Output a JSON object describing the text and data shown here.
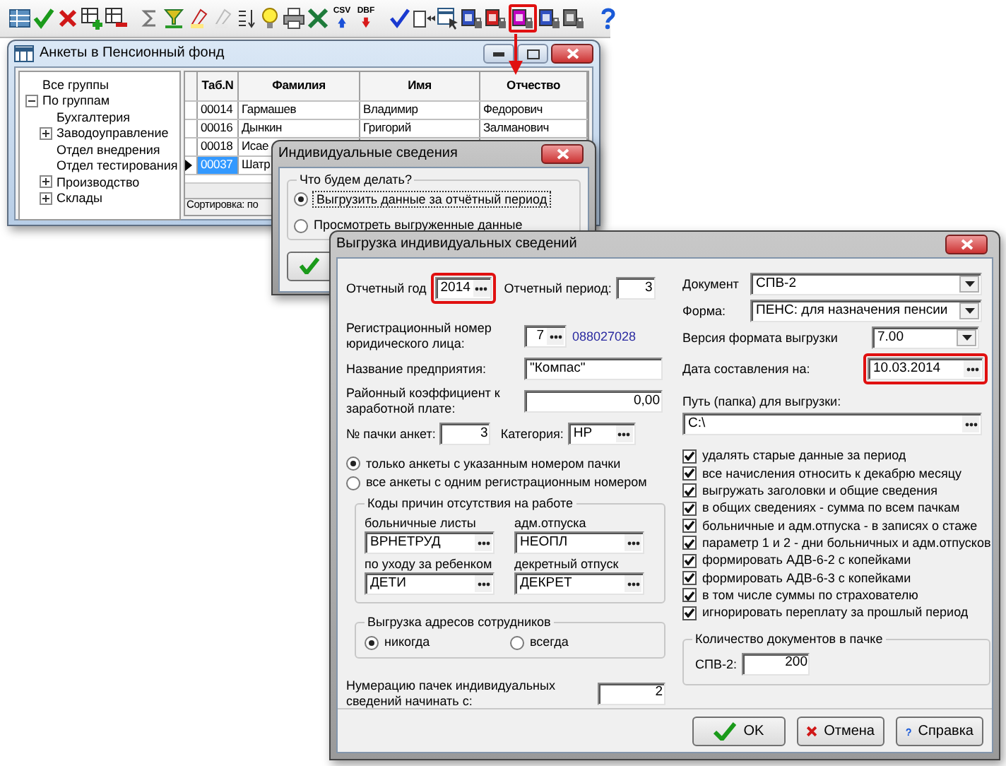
{
  "toolbar": {
    "groups": [
      [
        {
          "kind": "grid",
          "disabled": false,
          "highlighted": false
        },
        {
          "kind": "check",
          "disabled": false,
          "highlighted": false
        },
        {
          "kind": "cross",
          "disabled": false,
          "highlighted": false
        },
        {
          "kind": "add-row",
          "disabled": false,
          "highlighted": false
        },
        {
          "kind": "remove-row",
          "disabled": false,
          "highlighted": false
        }
      ],
      [
        {
          "kind": "sigma",
          "disabled": false,
          "highlighted": false
        },
        {
          "kind": "filter",
          "disabled": false,
          "highlighted": false
        },
        {
          "kind": "marker",
          "disabled": false,
          "highlighted": false
        },
        {
          "kind": "marker",
          "disabled": true,
          "highlighted": false
        },
        {
          "kind": "sort",
          "disabled": false,
          "highlighted": false
        },
        {
          "kind": "bulb",
          "disabled": false,
          "highlighted": false
        },
        {
          "kind": "printer",
          "disabled": false,
          "highlighted": false
        },
        {
          "kind": "excel",
          "disabled": false,
          "highlighted": false
        },
        {
          "kind": "export",
          "label": "CSV",
          "disabled": false,
          "highlighted": false
        },
        {
          "kind": "export-red",
          "label": "DBF",
          "disabled": false,
          "highlighted": false
        }
      ],
      [
        {
          "kind": "blue-check",
          "disabled": false,
          "highlighted": false
        },
        {
          "kind": "doc-arrow",
          "disabled": false,
          "highlighted": false
        },
        {
          "kind": "table-cursor",
          "disabled": false,
          "highlighted": false
        },
        {
          "kind": "doc-lock",
          "color": "#3050c0",
          "disabled": false,
          "highlighted": false
        },
        {
          "kind": "doc-lock",
          "color": "#d02020",
          "disabled": false,
          "highlighted": false
        },
        {
          "kind": "doc-lock",
          "color": "#c000c0",
          "disabled": false,
          "highlighted": true
        },
        {
          "kind": "doc-lock",
          "color": "#3050c0",
          "disabled": false,
          "highlighted": false
        },
        {
          "kind": "doc-lock",
          "color": "#707070",
          "disabled": false,
          "highlighted": false
        }
      ],
      [
        {
          "kind": "help",
          "disabled": false,
          "highlighted": false
        }
      ]
    ]
  },
  "back_window": {
    "title": "Анкеты в Пенсионный фонд",
    "tree": [
      {
        "label": "Все группы"
      },
      {
        "label": "По группам",
        "expanded": true,
        "children": [
          {
            "label": "Бухгалтерия"
          },
          {
            "label": "Заводоуправление",
            "expanded": false
          },
          {
            "label": "Отдел внедрения"
          },
          {
            "label": "Отдел тестирования"
          },
          {
            "label": "Производство",
            "expanded": false
          },
          {
            "label": "Склады",
            "expanded": false
          }
        ]
      }
    ],
    "table": {
      "columns": [
        "Таб.N",
        "Фамилия",
        "Имя",
        "Отчество"
      ],
      "rows": [
        {
          "cells": [
            "00014",
            "Гармашев",
            "Владимир",
            "Федорович"
          ],
          "selected": false
        },
        {
          "cells": [
            "00016",
            "Дынкин",
            "Григорий",
            "Залманович"
          ],
          "selected": false
        },
        {
          "cells": [
            "00018",
            "Исае",
            "",
            ""
          ],
          "selected": false
        },
        {
          "cells": [
            "00037",
            "Шатр",
            "",
            ""
          ],
          "selected": true
        }
      ]
    },
    "status_bar": "Сортировка: по"
  },
  "choice_dialog": {
    "title": "Индивидуальные сведения",
    "group_title": "Что будем делать?",
    "options": [
      {
        "label": "Выгрузить данные за отчётный период",
        "selected": true
      },
      {
        "label": "Просмотреть выгруженные данные",
        "selected": false
      }
    ]
  },
  "export_dialog": {
    "title": "Выгрузка индивидуальных сведений",
    "year": {
      "label": "Отчетный год",
      "field": {
        "value": "2014",
        "kind": "picker",
        "highlighted": true
      }
    },
    "period": {
      "label": "Отчетный период:",
      "field": {
        "value": "3"
      }
    },
    "reg_number": {
      "label": "Регистрационный номер юридического лица:",
      "field": {
        "value": "7",
        "kind": "picker"
      },
      "link": "088027028"
    },
    "company": {
      "label": "Название предприятия:",
      "field": {
        "value": "\"Компас\""
      }
    },
    "coefficient": {
      "label": "Районный коэффициент к заработной плате:",
      "field": {
        "value": "0,00"
      }
    },
    "pack": {
      "label": "№ пачки анкет:",
      "field": {
        "value": "3"
      }
    },
    "category": {
      "label": "Категория:",
      "field": {
        "value": "НР",
        "kind": "picker"
      }
    },
    "scope_options": [
      {
        "label": "только анкеты с указанным номером пачки",
        "selected": true
      },
      {
        "label": "все анкеты с одним регистрационным номером",
        "selected": false
      }
    ],
    "absence_codes": {
      "title": "Коды причин отсутствия на работе",
      "items": [
        {
          "label": "больничные листы",
          "field": {
            "value": "ВРНЕТРУД",
            "kind": "picker"
          }
        },
        {
          "label": "адм.отпуска",
          "field": {
            "value": "НЕОПЛ",
            "kind": "picker"
          }
        },
        {
          "label": "по уходу за ребенком",
          "field": {
            "value": "ДЕТИ",
            "kind": "picker"
          }
        },
        {
          "label": "декретный отпуск",
          "field": {
            "value": "ДЕКРЕТ",
            "kind": "picker"
          }
        }
      ]
    },
    "addresses": {
      "title": "Выгрузка адресов сотрудников",
      "options": [
        {
          "label": "никогда",
          "selected": true
        },
        {
          "label": "всегда",
          "selected": false
        }
      ]
    },
    "numbering": {
      "label": "Нумерацию пачек индивидуальных сведений начинать с:",
      "field": {
        "value": "2"
      }
    },
    "document": {
      "label": "Документ",
      "field": {
        "value": "СПВ-2",
        "kind": "combo"
      }
    },
    "form": {
      "label": "Форма:",
      "field": {
        "value": "ПЕНС: для назначения пенсии",
        "kind": "combo"
      }
    },
    "format_version": {
      "label": "Версия формата выгрузки",
      "field": {
        "value": "7.00",
        "kind": "combo"
      }
    },
    "date": {
      "label": "Дата составления на:",
      "field": {
        "value": "10.03.2014",
        "kind": "picker",
        "highlighted": true
      }
    },
    "path": {
      "label": "Путь (папка) для выгрузки:",
      "field": {
        "value": "C:\\",
        "kind": "picker"
      }
    },
    "options": [
      {
        "label": "удалять старые данные за период",
        "checked": true
      },
      {
        "label": "все начисления относить к декабрю месяцу",
        "checked": true
      },
      {
        "label": "выгружать заголовки и общие сведения",
        "checked": true
      },
      {
        "label": "в общих сведениях - сумма по всем пачкам",
        "checked": true
      },
      {
        "label": "больничные и адм.отпуска - в записях о стаже",
        "checked": true
      },
      {
        "label": "параметр 1 и 2 - дни больничных и адм.отпусков",
        "checked": true
      },
      {
        "label": "формировать АДВ-6-2 с копейками",
        "checked": true
      },
      {
        "label": "формировать АДВ-6-3 с копейками",
        "checked": true
      },
      {
        "label": "в том числе суммы по страхователю",
        "checked": true
      },
      {
        "label": "игнорировать переплату за прошлый период",
        "checked": true
      }
    ],
    "count": {
      "title": "Количество документов в пачке",
      "label": "СПВ-2:",
      "field": {
        "value": "200"
      }
    },
    "buttons": [
      {
        "label": "OK",
        "kind": "ok"
      },
      {
        "label": "Отмена",
        "kind": "cancel"
      },
      {
        "label": "Справка",
        "kind": "help"
      }
    ]
  }
}
